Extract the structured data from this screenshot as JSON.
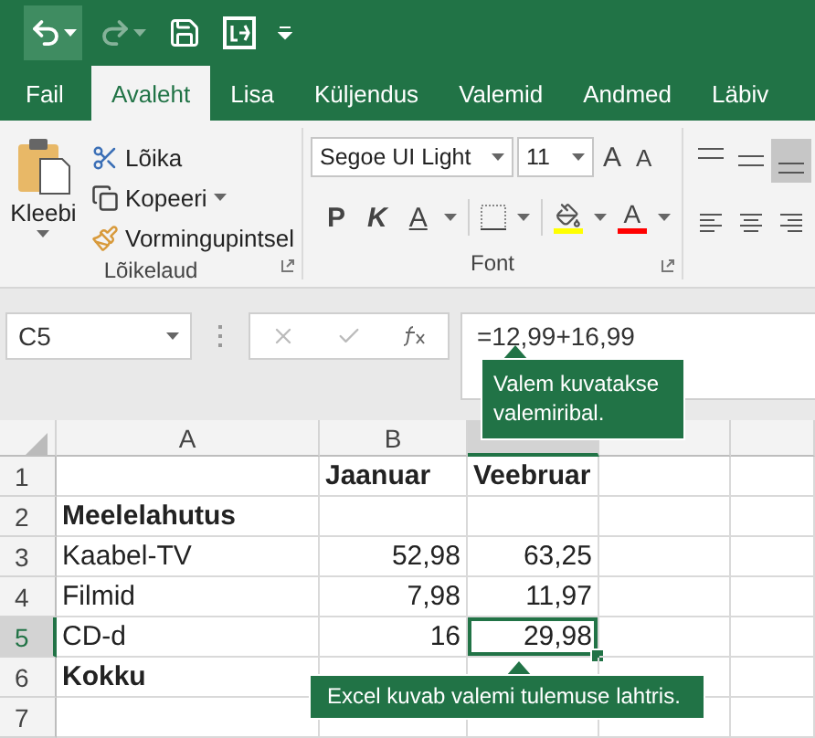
{
  "tabs": [
    {
      "label": "Fail",
      "selected": false
    },
    {
      "label": "Avaleht",
      "selected": true
    },
    {
      "label": "Lisa",
      "selected": false
    },
    {
      "label": "Küljendus",
      "selected": false
    },
    {
      "label": "Valemid",
      "selected": false
    },
    {
      "label": "Andmed",
      "selected": false
    },
    {
      "label": "Läbiv",
      "selected": false
    }
  ],
  "clipboard": {
    "paste": "Kleebi",
    "cut": "Lõika",
    "copy": "Kopeeri",
    "format_painter": "Vormingupintsel",
    "label": "Lõikelaud"
  },
  "font": {
    "name": "Segoe UI Light",
    "size": "11",
    "grow": "A",
    "shrink": "A",
    "bold": "P",
    "italic": "K",
    "underline": "A",
    "font_color": "A",
    "label": "Font"
  },
  "alignment": [
    {
      "kind": "top",
      "selected": false
    },
    {
      "kind": "middle",
      "selected": false
    },
    {
      "kind": "bottom",
      "selected": true
    },
    {
      "kind": "left",
      "selected": false
    },
    {
      "kind": "center",
      "selected": false
    },
    {
      "kind": "right",
      "selected": false
    }
  ],
  "formula_bar": {
    "name_box": "C5",
    "formula": "=12,99+16,99"
  },
  "callouts": [
    {
      "kind": "formula",
      "text": "Valem kuvatakse valemiribal."
    },
    {
      "kind": "cell",
      "text": "Excel kuvab valemi tulemuse lahtris."
    }
  ],
  "columns": [
    {
      "label": "A",
      "selected": false
    },
    {
      "label": "B",
      "selected": false
    },
    {
      "selected": true
    },
    {
      "selected": false
    },
    {
      "selected": false
    }
  ],
  "rows": [
    {
      "number": "1",
      "selected": false,
      "cells": [
        {
          "selected": false
        },
        {
          "text": "Jaanuar",
          "kind": "text",
          "bold": true,
          "selected": false
        },
        {
          "text": "Veebruar",
          "kind": "text",
          "bold": true,
          "selected": false
        },
        {
          "selected": false
        },
        {
          "selected": false
        }
      ]
    },
    {
      "number": "2",
      "selected": false,
      "cells": [
        {
          "text": "Meelelahutus",
          "kind": "text",
          "bold": true,
          "selected": false
        },
        {
          "selected": false
        },
        {
          "selected": false
        },
        {
          "selected": false
        },
        {
          "selected": false
        }
      ]
    },
    {
      "number": "3",
      "selected": false,
      "cells": [
        {
          "text": "Kaabel-TV",
          "kind": "text",
          "bold": false,
          "selected": false
        },
        {
          "text": "52,98",
          "kind": "number",
          "bold": false,
          "selected": false
        },
        {
          "text": "63,25",
          "kind": "number",
          "bold": false,
          "selected": false
        },
        {
          "selected": false
        },
        {
          "selected": false
        }
      ]
    },
    {
      "number": "4",
      "selected": false,
      "cells": [
        {
          "text": "Filmid",
          "kind": "text",
          "bold": false,
          "selected": false
        },
        {
          "text": "7,98",
          "kind": "number",
          "bold": false,
          "selected": false
        },
        {
          "text": "11,97",
          "kind": "number",
          "bold": false,
          "selected": false
        },
        {
          "selected": false
        },
        {
          "selected": false
        }
      ]
    },
    {
      "number": "5",
      "selected": true,
      "cells": [
        {
          "text": "CD-d",
          "kind": "text",
          "bold": false,
          "selected": false
        },
        {
          "text": "16",
          "kind": "number",
          "bold": false,
          "selected": false
        },
        {
          "text": "29,98",
          "kind": "number",
          "bold": false,
          "selected": true
        },
        {
          "selected": false
        },
        {
          "selected": false
        }
      ]
    },
    {
      "number": "6",
      "selected": false,
      "cells": [
        {
          "text": "Kokku",
          "kind": "text",
          "bold": true,
          "selected": false
        },
        {
          "selected": false
        },
        {
          "selected": false
        },
        {
          "selected": false
        },
        {
          "selected": false
        }
      ]
    },
    {
      "number": "7",
      "selected": false,
      "cells": [
        {
          "selected": false
        },
        {
          "selected": false
        },
        {
          "selected": false
        },
        {
          "selected": false
        },
        {
          "selected": false
        }
      ]
    }
  ]
}
